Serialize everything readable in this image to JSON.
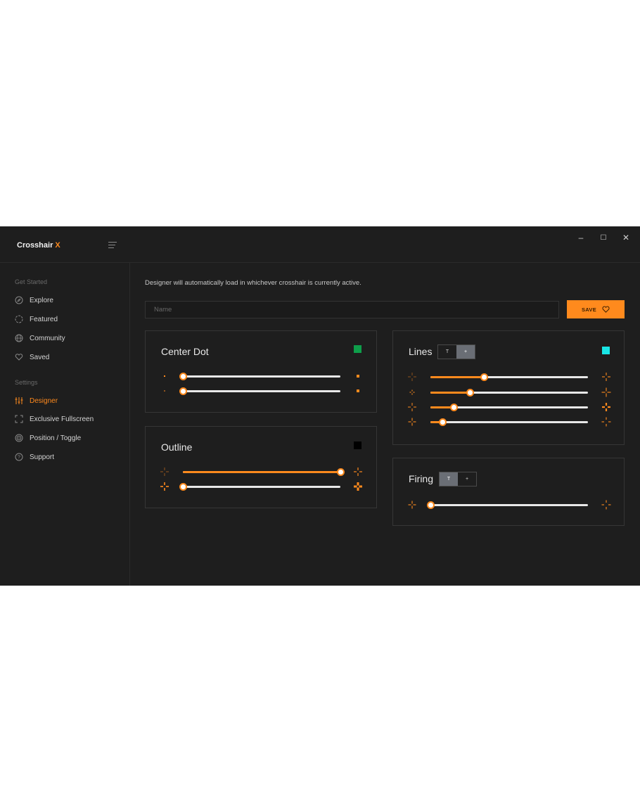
{
  "app": {
    "brand": "Crosshair",
    "brand_suffix": "X",
    "window_controls": {
      "minimize": "–",
      "maximize": "☐",
      "close": "✕"
    }
  },
  "sidebar": {
    "get_started_label": "Get Started",
    "get_started_items": [
      {
        "label": "Explore",
        "icon": "compass-icon"
      },
      {
        "label": "Featured",
        "icon": "target-circle-icon"
      },
      {
        "label": "Community",
        "icon": "globe-icon"
      },
      {
        "label": "Saved",
        "icon": "heart-icon"
      }
    ],
    "settings_label": "Settings",
    "settings_items": [
      {
        "label": "Designer",
        "icon": "sliders-icon",
        "active": true
      },
      {
        "label": "Exclusive Fullscreen",
        "icon": "fullscreen-icon"
      },
      {
        "label": "Position / Toggle",
        "icon": "crosshair-target-icon"
      },
      {
        "label": "Support",
        "icon": "help-icon"
      }
    ]
  },
  "main": {
    "info": "Designer will automatically load in whichever crosshair is currently active.",
    "name_placeholder": "Name",
    "save_label": "SAVE"
  },
  "colors": {
    "accent": "#ff8a1d",
    "center_dot": "#0e9e4a",
    "outline": "#000000",
    "lines": "#19e6e6"
  },
  "cards": {
    "center_dot": {
      "title": "Center Dot",
      "sliders": [
        0.0,
        0.0
      ]
    },
    "outline": {
      "title": "Outline",
      "sliders": [
        1.0,
        0.0
      ]
    },
    "lines": {
      "title": "Lines",
      "toggle": [
        "T",
        "+"
      ],
      "active_toggle": "+",
      "sliders": [
        0.34,
        0.25,
        0.15,
        0.08
      ]
    },
    "firing": {
      "title": "Firing",
      "toggle": [
        "T",
        "+"
      ],
      "active_toggle": "T",
      "sliders": [
        0.0
      ]
    }
  }
}
